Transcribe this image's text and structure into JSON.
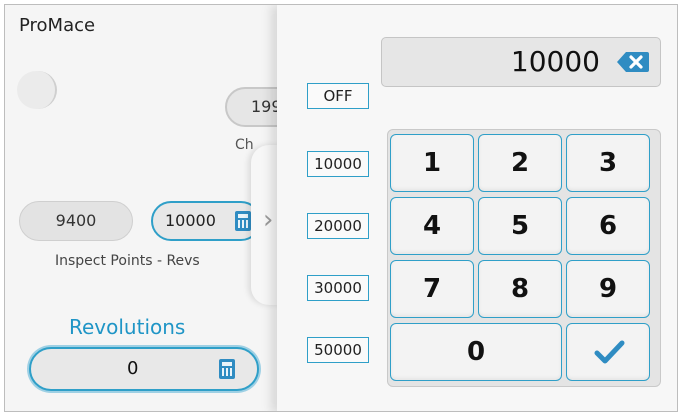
{
  "app": {
    "title": "ProMace"
  },
  "background": {
    "change_value": "199",
    "change_label": "Ch",
    "inspect_current": "9400",
    "inspect_setpoint": "10000",
    "inspect_label": "Inspect Points - Revs",
    "revolutions_label": "Revolutions",
    "revolutions_value": "0"
  },
  "keypad": {
    "display_value": "10000",
    "presets": [
      "OFF",
      "10000",
      "20000",
      "30000",
      "50000"
    ],
    "keys": [
      "1",
      "2",
      "3",
      "4",
      "5",
      "6",
      "7",
      "8",
      "9",
      "0"
    ]
  },
  "icons": {
    "backspace": "backspace-icon",
    "calculator": "calculator-icon",
    "confirm": "checkmark-icon",
    "collapse": "chevron-right-icon"
  },
  "colors": {
    "accent": "#2f9fc8",
    "icon": "#2f8cc2",
    "text": "#111111"
  }
}
